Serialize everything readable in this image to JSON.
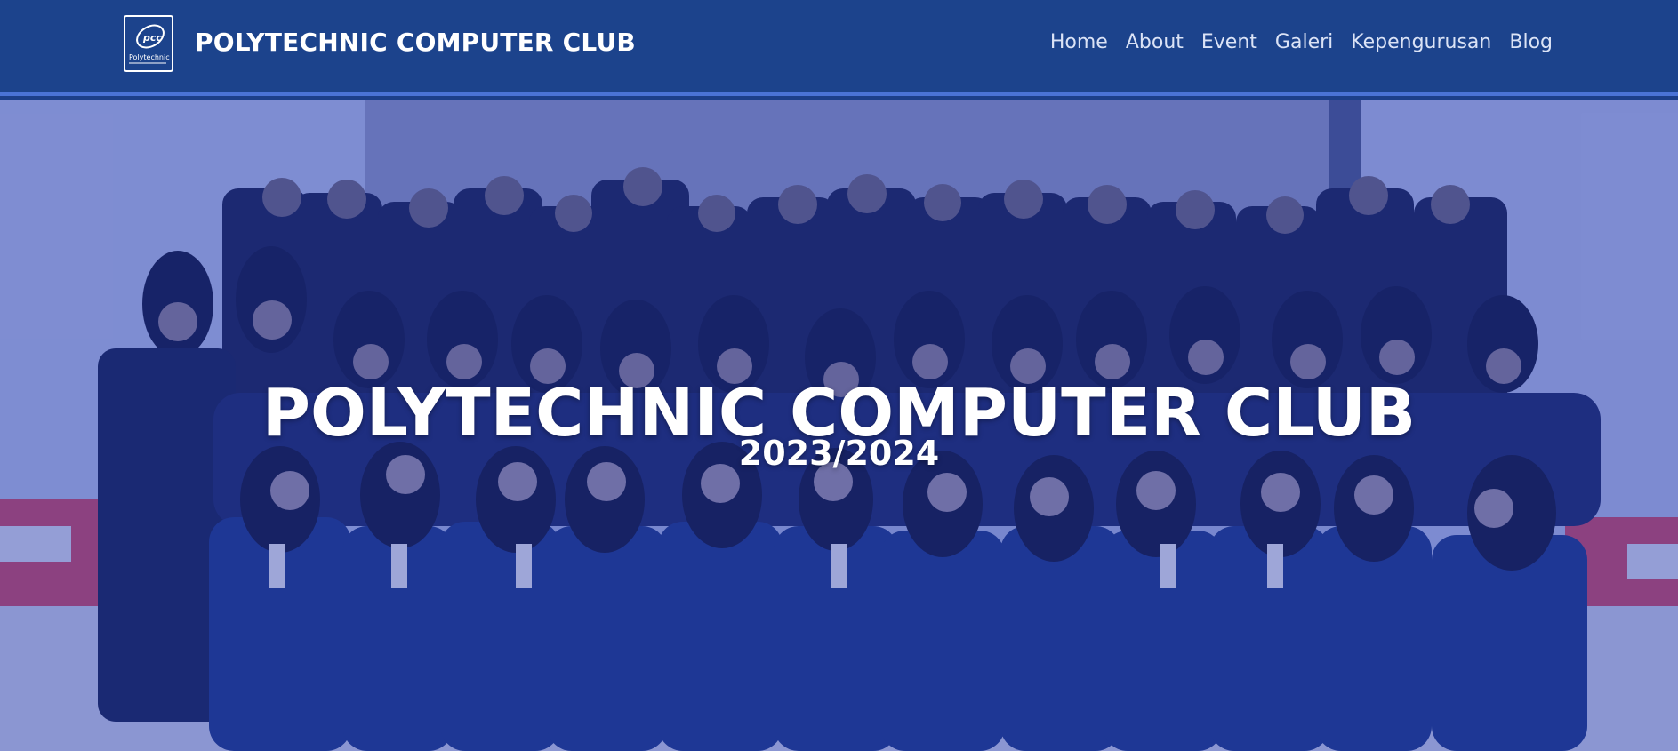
{
  "header": {
    "brand_name": "POLYTECHNIC COMPUTER CLUB",
    "logo_icon": "pcc-logo",
    "nav": [
      {
        "label": "Home"
      },
      {
        "label": "About"
      },
      {
        "label": "Event"
      },
      {
        "label": "Galeri"
      },
      {
        "label": "Kepengurusan"
      },
      {
        "label": "Blog"
      }
    ]
  },
  "hero": {
    "title": "POLYTECHNIC COMPUTER CLUB",
    "subtitle": "2023/2024",
    "image": "group-photo"
  },
  "colors": {
    "navbar_bg": "#1c438c",
    "navbar_border": "#4a73d6",
    "overlay": "#1e34aa",
    "jacket": "#1f3a8a"
  }
}
